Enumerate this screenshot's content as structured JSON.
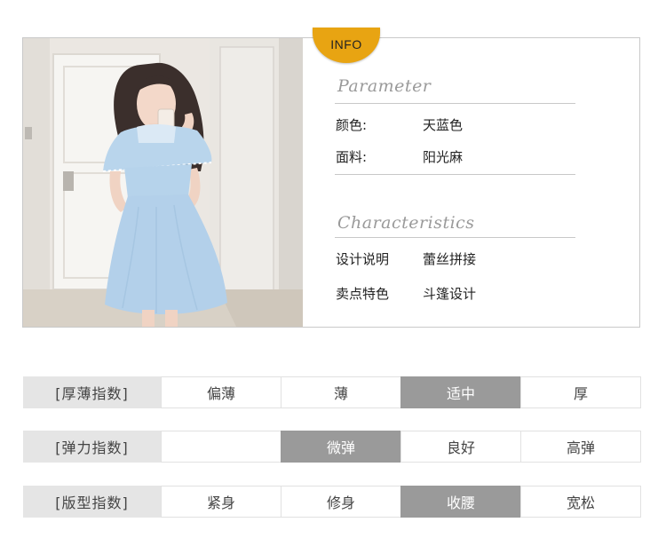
{
  "info_tab": "INFO",
  "parameter": {
    "heading": "Parameter",
    "rows": [
      {
        "label": "颜色:",
        "value": "天蓝色"
      },
      {
        "label": "面料:",
        "value": "阳光麻"
      }
    ]
  },
  "characteristics": {
    "heading": "Characteristics",
    "rows": [
      {
        "label": "设计说明",
        "value": "蕾丝拼接"
      },
      {
        "label": "卖点特色",
        "value": "斗篷设计"
      }
    ]
  },
  "indices": [
    {
      "title": "[厚薄指数]",
      "options": [
        "偏薄",
        "薄",
        "适中",
        "厚"
      ],
      "selected": 2
    },
    {
      "title": "[弹力指数]",
      "options": [
        "",
        "微弹",
        "良好",
        "高弹"
      ],
      "selected": 1
    },
    {
      "title": "[版型指数]",
      "options": [
        "紧身",
        "修身",
        "收腰",
        "宽松"
      ],
      "selected": 2
    }
  ],
  "colors": {
    "accent": "#e8a412",
    "selected_cell": "#9a9a9a",
    "header_cell": "#e5e5e5"
  }
}
